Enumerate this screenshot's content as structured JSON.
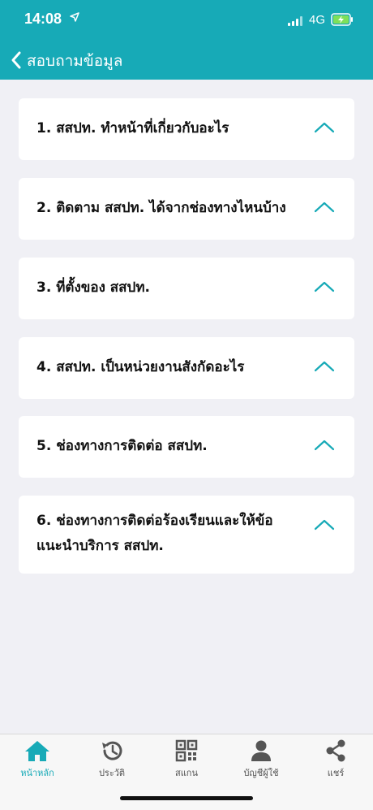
{
  "status_bar": {
    "time": "14:08",
    "network": "4G"
  },
  "header": {
    "title": "สอบถามข้อมูล"
  },
  "faq": {
    "items": [
      {
        "label": "1. สสปท. ทำหน้าที่เกี่ยวกับอะไร"
      },
      {
        "label": "2. ติดตาม สสปท. ได้จากช่องทางไหนบ้าง"
      },
      {
        "label": "3. ที่ตั้งของ สสปท."
      },
      {
        "label": "4. สสปท. เป็นหน่วยงานสังกัดอะไร"
      },
      {
        "label": "5. ช่องทางการติดต่อ สสปท."
      },
      {
        "label": "6. ช่องทางการติดต่อร้องเรียนและให้ข้อแนะนำบริการ สสปท."
      }
    ]
  },
  "tab_bar": {
    "tabs": [
      {
        "label": "หน้าหลัก",
        "icon": "home-icon",
        "active": true
      },
      {
        "label": "ประวัติ",
        "icon": "history-icon"
      },
      {
        "label": "สแกน",
        "icon": "qr-code-icon"
      },
      {
        "label": "บัญชีผู้ใช้",
        "icon": "user-icon"
      },
      {
        "label": "แชร์",
        "icon": "share-icon"
      }
    ]
  },
  "colors": {
    "accent": "#17aab7",
    "background": "#f0f0f5",
    "card": "#ffffff"
  }
}
